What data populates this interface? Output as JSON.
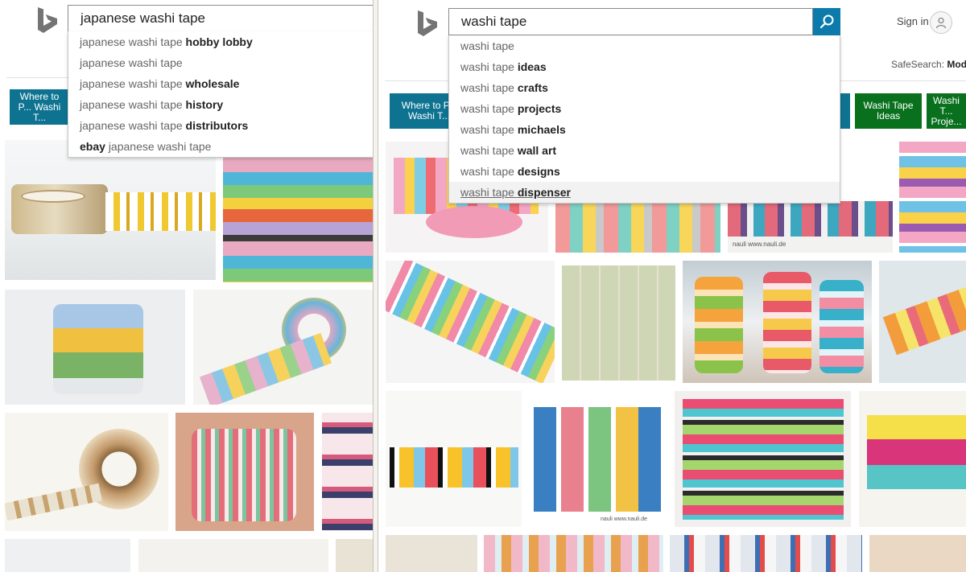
{
  "left": {
    "query": "japanese washi tape",
    "suggestions": [
      {
        "plain": "japanese washi tape ",
        "bold": "hobby lobby"
      },
      {
        "plain": "japanese washi tape",
        "bold": ""
      },
      {
        "plain": "japanese washi tape ",
        "bold": "wholesale"
      },
      {
        "plain": "japanese washi tape ",
        "bold": "history"
      },
      {
        "plain": "japanese washi tape ",
        "bold": "distributors"
      },
      {
        "pre": "ebay ",
        "plain": "japanese washi tape",
        "bold": ""
      }
    ],
    "chip_label": "Where to P... Washi T..."
  },
  "right": {
    "query": "washi tape",
    "suggestions": [
      {
        "plain": "washi tape",
        "bold": ""
      },
      {
        "plain": "washi tape ",
        "bold": "ideas"
      },
      {
        "plain": "washi tape ",
        "bold": "crafts"
      },
      {
        "plain": "washi tape ",
        "bold": "projects"
      },
      {
        "plain": "washi tape ",
        "bold": "michaels"
      },
      {
        "plain": "washi tape ",
        "bold": "wall art"
      },
      {
        "plain": "washi tape ",
        "bold": "designs"
      },
      {
        "plain": "washi tape ",
        "bold": "dispenser"
      }
    ],
    "sign_in": "Sign in",
    "safesearch_label": "SafeSearch:",
    "safesearch_value": "Mod",
    "chips": [
      {
        "label": "Where to P... Washi T...",
        "color": "blue"
      },
      {
        "label": "Washi Tape Ideas",
        "color": "green"
      },
      {
        "label": "Washi T... Proje...",
        "color": "green"
      }
    ]
  },
  "brand_colors": {
    "bing_logo": "#747474",
    "search_button": "#0c7bab",
    "chip_blue": "#0e7391",
    "chip_green": "#09711e"
  },
  "icons": {
    "logo": "bing-logo-icon",
    "search": "magnifier-icon",
    "user": "user-icon"
  }
}
